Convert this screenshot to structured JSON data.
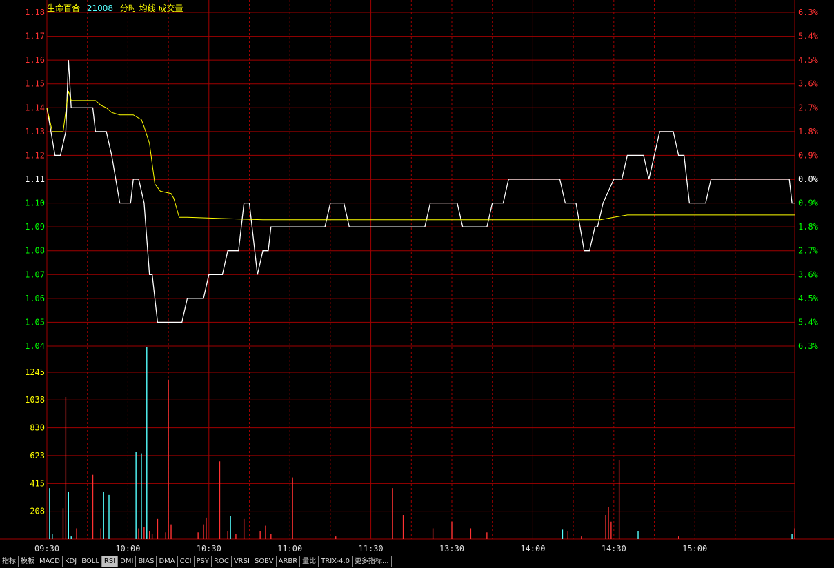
{
  "header": {
    "stock_name": "生命百合",
    "stock_code": "21008",
    "view_label": "分时 均线 成交量"
  },
  "colors": {
    "grid": "#a00000",
    "price_line": "#ffffff",
    "avg_line": "#ffff00",
    "up": "#ff3232",
    "down": "#00ff00",
    "volume_label": "#ffff00",
    "vol_up": "#ff3232",
    "vol_down": "#54ffff"
  },
  "tabs": [
    "指标",
    "模板",
    "MACD",
    "KDJ",
    "BOLL",
    "RSI",
    "DMI",
    "BIAS",
    "DMA",
    "CCI",
    "PSY",
    "ROC",
    "VRSI",
    "SOBV",
    "ARBR",
    "量比",
    "TRIX-4.0",
    "更多指标..."
  ],
  "chart_data": {
    "type": "line",
    "x_labels": [
      "09:30",
      "10:00",
      "10:30",
      "11:00",
      "11:30",
      "13:30",
      "14:00",
      "14:30",
      "15:00"
    ],
    "price_axis": {
      "ticks": [
        "1.18",
        "1.17",
        "1.16",
        "1.15",
        "1.14",
        "1.13",
        "1.12",
        "1.11",
        "1.10",
        "1.09",
        "1.08",
        "1.07",
        "1.06",
        "1.05",
        "1.04"
      ],
      "values": [
        1.18,
        1.17,
        1.16,
        1.15,
        1.14,
        1.13,
        1.12,
        1.11,
        1.1,
        1.09,
        1.08,
        1.07,
        1.06,
        1.05,
        1.04
      ],
      "prev_close": 1.11
    },
    "pct_axis": [
      "6.3%",
      "5.4%",
      "4.5%",
      "3.6%",
      "2.7%",
      "1.8%",
      "0.9%",
      "0.0%",
      "0.9%",
      "1.8%",
      "2.7%",
      "3.6%",
      "4.5%",
      "5.4%",
      "6.3%"
    ],
    "volume_axis": {
      "ticks": [
        "1245",
        "1038",
        "830",
        "623",
        "415",
        "208"
      ],
      "values": [
        1245,
        1038,
        830,
        623,
        415,
        208
      ]
    },
    "series": [
      {
        "name": "price",
        "points": [
          [
            0,
            1.14
          ],
          [
            3,
            1.12
          ],
          [
            5,
            1.12
          ],
          [
            7,
            1.13
          ],
          [
            8,
            1.16
          ],
          [
            9,
            1.14
          ],
          [
            17,
            1.14
          ],
          [
            18,
            1.13
          ],
          [
            22,
            1.13
          ],
          [
            24,
            1.12
          ],
          [
            27,
            1.1
          ],
          [
            31,
            1.1
          ],
          [
            32,
            1.11
          ],
          [
            34,
            1.11
          ],
          [
            36,
            1.1
          ],
          [
            38,
            1.07
          ],
          [
            39,
            1.07
          ],
          [
            41,
            1.05
          ],
          [
            50,
            1.05
          ],
          [
            52,
            1.06
          ],
          [
            58,
            1.06
          ],
          [
            60,
            1.07
          ],
          [
            65,
            1.07
          ],
          [
            67,
            1.08
          ],
          [
            71,
            1.08
          ],
          [
            73,
            1.1
          ],
          [
            75,
            1.1
          ],
          [
            77,
            1.08
          ],
          [
            78,
            1.07
          ],
          [
            80,
            1.08
          ],
          [
            82,
            1.08
          ],
          [
            83,
            1.09
          ],
          [
            103,
            1.09
          ],
          [
            105,
            1.1
          ],
          [
            110,
            1.1
          ],
          [
            112,
            1.09
          ],
          [
            140,
            1.09
          ],
          [
            142,
            1.1
          ],
          [
            152,
            1.1
          ],
          [
            154,
            1.09
          ],
          [
            163,
            1.09
          ],
          [
            165,
            1.1
          ],
          [
            169,
            1.1
          ],
          [
            171,
            1.11
          ],
          [
            190,
            1.11
          ],
          [
            192,
            1.1
          ],
          [
            196,
            1.1
          ],
          [
            199,
            1.08
          ],
          [
            201,
            1.08
          ],
          [
            203,
            1.09
          ],
          [
            204,
            1.09
          ],
          [
            206,
            1.1
          ],
          [
            210,
            1.11
          ],
          [
            213,
            1.11
          ],
          [
            215,
            1.12
          ],
          [
            221,
            1.12
          ],
          [
            223,
            1.11
          ],
          [
            225,
            1.12
          ],
          [
            227,
            1.13
          ],
          [
            232,
            1.13
          ],
          [
            234,
            1.12
          ],
          [
            236,
            1.12
          ],
          [
            238,
            1.1
          ],
          [
            244,
            1.1
          ],
          [
            246,
            1.11
          ],
          [
            257,
            1.11
          ],
          [
            262,
            1.11
          ],
          [
            275,
            1.11
          ],
          [
            276,
            1.1
          ],
          [
            277,
            1.1
          ]
        ]
      },
      {
        "name": "average",
        "points": [
          [
            0,
            1.14
          ],
          [
            2,
            1.13
          ],
          [
            6,
            1.13
          ],
          [
            8,
            1.147
          ],
          [
            9,
            1.143
          ],
          [
            18,
            1.143
          ],
          [
            20,
            1.141
          ],
          [
            22,
            1.14
          ],
          [
            24,
            1.138
          ],
          [
            27,
            1.137
          ],
          [
            32,
            1.137
          ],
          [
            35,
            1.135
          ],
          [
            36,
            1.132
          ],
          [
            38,
            1.125
          ],
          [
            40,
            1.108
          ],
          [
            42,
            1.105
          ],
          [
            46,
            1.104
          ],
          [
            47,
            1.102
          ],
          [
            49,
            1.094
          ],
          [
            52,
            1.094
          ],
          [
            65,
            1.0935
          ],
          [
            80,
            1.093
          ],
          [
            100,
            1.093
          ],
          [
            140,
            1.093
          ],
          [
            180,
            1.093
          ],
          [
            205,
            1.093
          ],
          [
            210,
            1.094
          ],
          [
            215,
            1.095
          ],
          [
            220,
            1.095
          ],
          [
            250,
            1.095
          ],
          [
            277,
            1.095
          ]
        ]
      }
    ],
    "volume": [
      [
        1,
        380,
        "down"
      ],
      [
        2,
        40,
        "down"
      ],
      [
        6,
        230,
        "up"
      ],
      [
        7,
        1060,
        "up"
      ],
      [
        8,
        350,
        "down"
      ],
      [
        9,
        20,
        "down"
      ],
      [
        11,
        80,
        "up"
      ],
      [
        17,
        480,
        "up"
      ],
      [
        20,
        80,
        "up"
      ],
      [
        21,
        350,
        "down"
      ],
      [
        23,
        330,
        "down"
      ],
      [
        33,
        650,
        "down"
      ],
      [
        34,
        80,
        "up"
      ],
      [
        35,
        640,
        "down"
      ],
      [
        36,
        90,
        "up"
      ],
      [
        37,
        1430,
        "down"
      ],
      [
        38,
        60,
        "up"
      ],
      [
        39,
        40,
        "up"
      ],
      [
        41,
        150,
        "up"
      ],
      [
        44,
        50,
        "up"
      ],
      [
        45,
        1190,
        "up"
      ],
      [
        46,
        110,
        "up"
      ],
      [
        56,
        50,
        "up"
      ],
      [
        58,
        110,
        "up"
      ],
      [
        59,
        160,
        "up"
      ],
      [
        64,
        580,
        "up"
      ],
      [
        67,
        60,
        "up"
      ],
      [
        68,
        170,
        "down"
      ],
      [
        70,
        40,
        "up"
      ],
      [
        73,
        150,
        "up"
      ],
      [
        79,
        60,
        "up"
      ],
      [
        81,
        100,
        "up"
      ],
      [
        83,
        40,
        "up"
      ],
      [
        91,
        460,
        "up"
      ],
      [
        107,
        20,
        "up"
      ],
      [
        128,
        380,
        "up"
      ],
      [
        132,
        180,
        "up"
      ],
      [
        143,
        80,
        "up"
      ],
      [
        150,
        130,
        "up"
      ],
      [
        157,
        80,
        "up"
      ],
      [
        163,
        50,
        "up"
      ],
      [
        191,
        70,
        "down"
      ],
      [
        193,
        60,
        "up"
      ],
      [
        198,
        20,
        "up"
      ],
      [
        207,
        180,
        "up"
      ],
      [
        208,
        240,
        "up"
      ],
      [
        209,
        130,
        "up"
      ],
      [
        212,
        590,
        "up"
      ],
      [
        219,
        60,
        "down"
      ],
      [
        234,
        20,
        "up"
      ],
      [
        276,
        40,
        "down"
      ],
      [
        277,
        80,
        "up"
      ]
    ]
  }
}
